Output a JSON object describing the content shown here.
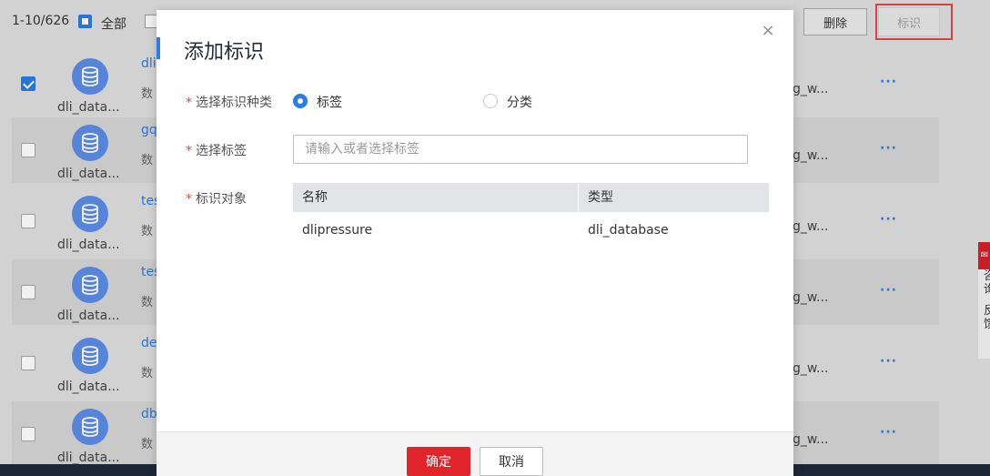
{
  "toolbar": {
    "pager": "1-10/626",
    "select_all_label": "全部",
    "delete_label": "删除",
    "tag_label": "标识"
  },
  "rows": [
    {
      "checked": true,
      "name": "dli_data...",
      "link": "dli",
      "desc": "数",
      "owner": "g_w...",
      "more": "···"
    },
    {
      "checked": false,
      "name": "dli_data...",
      "link": "gq",
      "desc": "数",
      "owner": "g_w...",
      "more": "···"
    },
    {
      "checked": false,
      "name": "dli_data...",
      "link": "tes",
      "desc": "数",
      "owner": "g_w...",
      "more": "···"
    },
    {
      "checked": false,
      "name": "dli_data...",
      "link": "tes",
      "desc": "数",
      "owner": "g_w...",
      "more": "···"
    },
    {
      "checked": false,
      "name": "dli_data...",
      "link": "de",
      "desc": "数",
      "owner": "g_w...",
      "more": "···"
    },
    {
      "checked": false,
      "name": "dli_data...",
      "link": "db",
      "desc": "数",
      "owner": "g_w...",
      "more": "···"
    }
  ],
  "side_tool": {
    "item1": "咨询",
    "item2": "反馈"
  },
  "modal": {
    "title": "添加标识",
    "close_symbol": "×",
    "type_label": "选择标识种类",
    "required_mark": "*",
    "radio_tag_label": "标签",
    "radio_category_label": "分类",
    "selected_type": "标签",
    "select_tag_label": "选择标签",
    "tag_input_placeholder": "请输入或者选择标签",
    "tag_input_value": "",
    "target_label": "标识对象",
    "table": {
      "columns": [
        "名称",
        "类型"
      ],
      "rows": [
        {
          "name": "dlipressure",
          "type": "dli_database"
        }
      ]
    },
    "ok_label": "确定",
    "cancel_label": "取消"
  },
  "colors": {
    "accent": "#2a7ce8",
    "primary_button": "#e1232c",
    "highlight_border": "#e2474c"
  }
}
